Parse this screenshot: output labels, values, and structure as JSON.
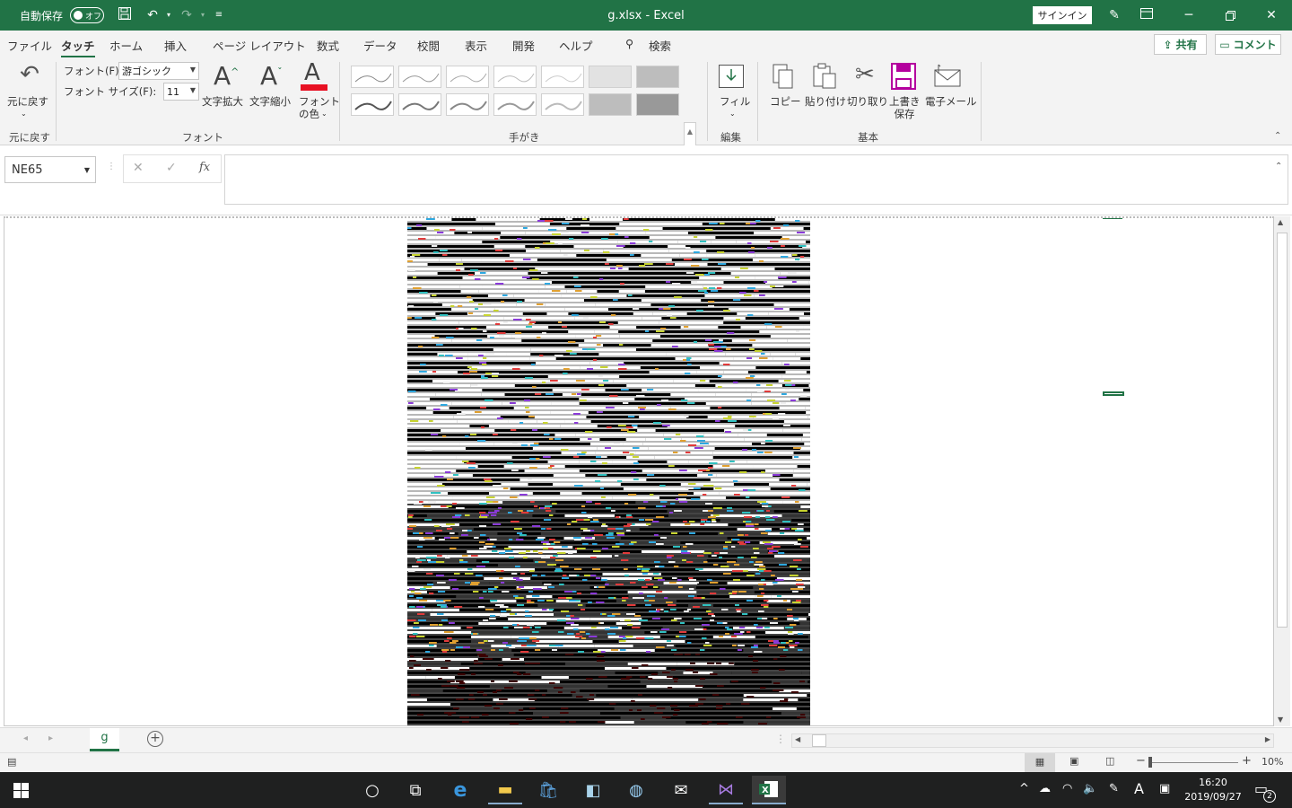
{
  "titlebar": {
    "autosave_label": "自動保存",
    "autosave_state": "オフ",
    "doc_title": "g.xlsx  -  Excel",
    "signin_label": "サインイン",
    "accent_color": "#217346"
  },
  "menu": {
    "tabs": [
      "ファイル",
      "タッチ",
      "ホーム",
      "挿入",
      "ページ レイアウト",
      "数式",
      "データ",
      "校閲",
      "表示",
      "開発",
      "ヘルプ"
    ],
    "active_tab": "タッチ",
    "search_label": "検索",
    "share_label": "共有",
    "comment_label": "コメント"
  },
  "ribbon": {
    "undo_label": "元に戻す",
    "undo_group": "元に戻す",
    "font_label": "フォント(F):",
    "font_value": "游ゴシック",
    "size_label": "フォント サイズ(F):",
    "size_value": "11",
    "grow_label": "文字拡大",
    "shrink_label": "文字縮小",
    "font_color_label": "フォント\nの色",
    "font_color": "#e81123",
    "font_group": "フォント",
    "pen_group": "手がき",
    "fill_label": "フィル",
    "edit_group": "編集",
    "copy_label": "コピー",
    "paste_label": "貼り付け",
    "cut_label": "切り取り",
    "save_label": "上書き\n保存",
    "email_label": "電子メール",
    "basic_group": "基本"
  },
  "formula": {
    "namebox": "NE65",
    "fx": "fx",
    "cancel_glyph": "✕",
    "enter_glyph": "✓"
  },
  "sheets": {
    "active": "g"
  },
  "status": {
    "zoom": "10%"
  },
  "taskbar": {
    "time": "16:20",
    "date": "2019/09/27",
    "notifications": "2",
    "ime": "A"
  }
}
